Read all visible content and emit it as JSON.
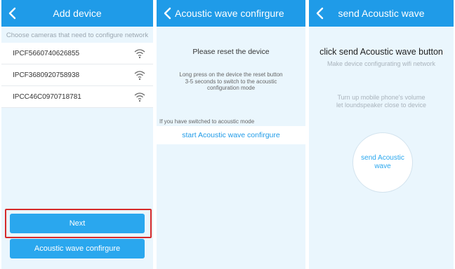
{
  "panel1": {
    "title": "Add device",
    "hint": "Choose cameras that need to configure network",
    "cameras": [
      "IPCF5660740626855",
      "IPCF3680920758938",
      "IPCC46C0970718781"
    ],
    "next_label": "Next",
    "acoustic_label": "Acoustic wave confirgure"
  },
  "panel2": {
    "title": "Acoustic wave confirgure",
    "reset_title": "Please reset the device",
    "reset_desc": "Long press on the device the reset button 3-5 seconds to switch to the acoustic configuration mode",
    "switched_note": "If you have switched to acoustic mode",
    "start_label": "start Acoustic wave confirgure"
  },
  "panel3": {
    "title": "send Acoustic wave",
    "click_title": "click send Acoustic wave button",
    "click_sub": "Make device configurating wifi network",
    "volume_hint_1": "Turn up mobile phone's volume",
    "volume_hint_2": "let loundspeaker close to device",
    "send_label": "send Acoustic wave"
  },
  "colors": {
    "header": "#1f9be8",
    "button": "#2aa7ee",
    "panel_bg": "#eaf6fd",
    "highlight": "#d62a2a"
  },
  "icons": [
    "back-arrow-icon",
    "wifi-icon"
  ]
}
